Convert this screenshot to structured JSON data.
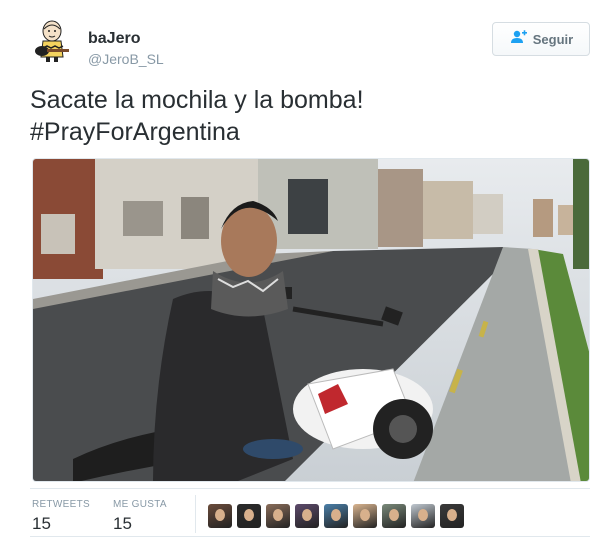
{
  "user": {
    "name": "baJero",
    "handle": "@JeroB_SL"
  },
  "follow": {
    "label": "Seguir",
    "icon": "add-user-icon"
  },
  "tweet": {
    "line1": "Sacate la mochila y la bomba!",
    "line2": "#PrayForArgentina"
  },
  "stats": {
    "retweets_label": "RETWEETS",
    "retweets_value": "15",
    "likes_label": "ME GUSTA",
    "likes_value": "15"
  },
  "colors": {
    "accent": "#1da1f2",
    "text": "#292f33",
    "muted": "#8899a6",
    "border": "#e1e8ed"
  },
  "likers": [
    {
      "color": "#6b4c3b"
    },
    {
      "color": "#2b2b2b"
    },
    {
      "color": "#8a6d5a"
    },
    {
      "color": "#5d4a6b"
    },
    {
      "color": "#4a7fa8"
    },
    {
      "color": "#d9b48f"
    },
    {
      "color": "#7a8a7a"
    },
    {
      "color": "#c0c8d0"
    },
    {
      "color": "#3a3a3a"
    }
  ]
}
